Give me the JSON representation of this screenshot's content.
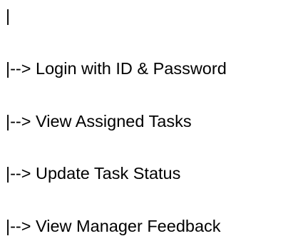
{
  "lines": [
    "|",
    "|--> Login with ID & Password",
    "|--> View Assigned Tasks",
    "|--> Update Task Status",
    "|--> View Manager Feedback"
  ]
}
